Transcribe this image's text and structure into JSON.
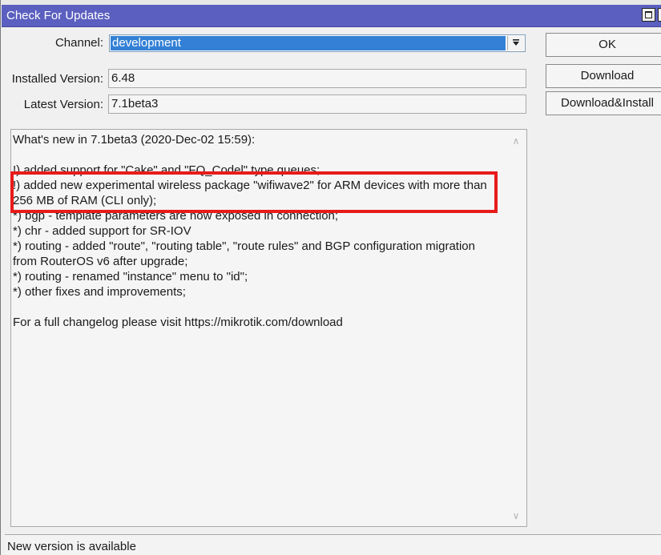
{
  "window": {
    "title": "Check For Updates"
  },
  "form": {
    "channel_label": "Channel:",
    "channel_value": "development",
    "installed_label": "Installed Version:",
    "installed_value": "6.48",
    "latest_label": "Latest Version:",
    "latest_value": "7.1beta3"
  },
  "buttons": {
    "ok": "OK",
    "download": "Download",
    "download_install": "Download&Install"
  },
  "changelog": [
    "What's new in 7.1beta3 (2020-Dec-02 15:59):",
    "",
    "!) added support for \"Cake\" and \"FQ_Codel\" type queues;",
    "!) added new experimental wireless package \"wifiwave2\" for ARM devices with more than",
    "256 MB of RAM (CLI only);",
    "*) bgp - template parameters are now exposed in connection;",
    "*) chr - added support for SR-IOV",
    "*) routing - added \"route\", \"routing table\", \"route rules\" and BGP configuration migration",
    "from RouterOS v6 after upgrade;",
    "*) routing - renamed \"instance\" menu to \"id\";",
    "*) other fixes and improvements;",
    "",
    "For a full changelog please visit https://mikrotik.com/download"
  ],
  "status": {
    "text": "New version is available"
  },
  "colors": {
    "title_bar": "#5b5fbf",
    "selection": "#3380d6",
    "highlight": "#e81b1b"
  },
  "icons": {
    "maximize": "maximize-icon",
    "restore": "restore-icon",
    "dropdown": "dropdown-arrow-icon"
  }
}
